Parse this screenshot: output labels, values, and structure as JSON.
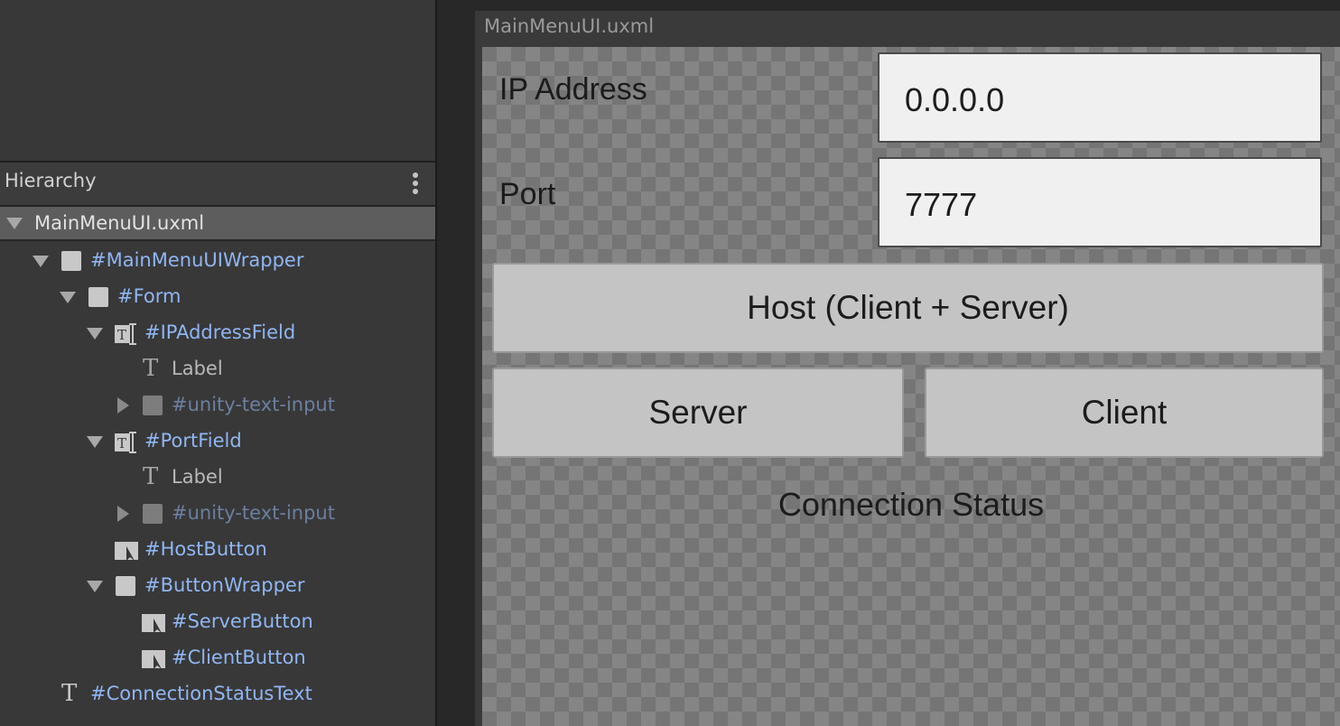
{
  "hierarchy": {
    "title": "Hierarchy",
    "root": "MainMenuUI.uxml",
    "items": [
      {
        "label": "#MainMenuUIWrapper",
        "icon": "visual-element-icon"
      },
      {
        "label": "#Form",
        "icon": "visual-element-icon"
      },
      {
        "label": "#IPAddressField",
        "icon": "text-field-icon"
      },
      {
        "label": "Label",
        "icon": "label-icon"
      },
      {
        "label": "#unity-text-input",
        "icon": "visual-element-icon"
      },
      {
        "label": "#PortField",
        "icon": "text-field-icon"
      },
      {
        "label": "Label",
        "icon": "label-icon"
      },
      {
        "label": "#unity-text-input",
        "icon": "visual-element-icon"
      },
      {
        "label": "#HostButton",
        "icon": "button-icon"
      },
      {
        "label": "#ButtonWrapper",
        "icon": "visual-element-icon"
      },
      {
        "label": "#ServerButton",
        "icon": "button-icon"
      },
      {
        "label": "#ClientButton",
        "icon": "button-icon"
      },
      {
        "label": "#ConnectionStatusText",
        "icon": "label-icon"
      }
    ]
  },
  "canvas": {
    "document_title": "MainMenuUI.uxml",
    "ip_label": "IP Address",
    "ip_value": "0.0.0.0",
    "port_label": "Port",
    "port_value": "7777",
    "host_button": "Host (Client + Server)",
    "server_button": "Server",
    "client_button": "Client",
    "status_text": "Connection Status"
  },
  "colors": {
    "element_name": "#90b6f2",
    "panel_bg": "#383838",
    "selected_row": "#5d5d5d"
  }
}
